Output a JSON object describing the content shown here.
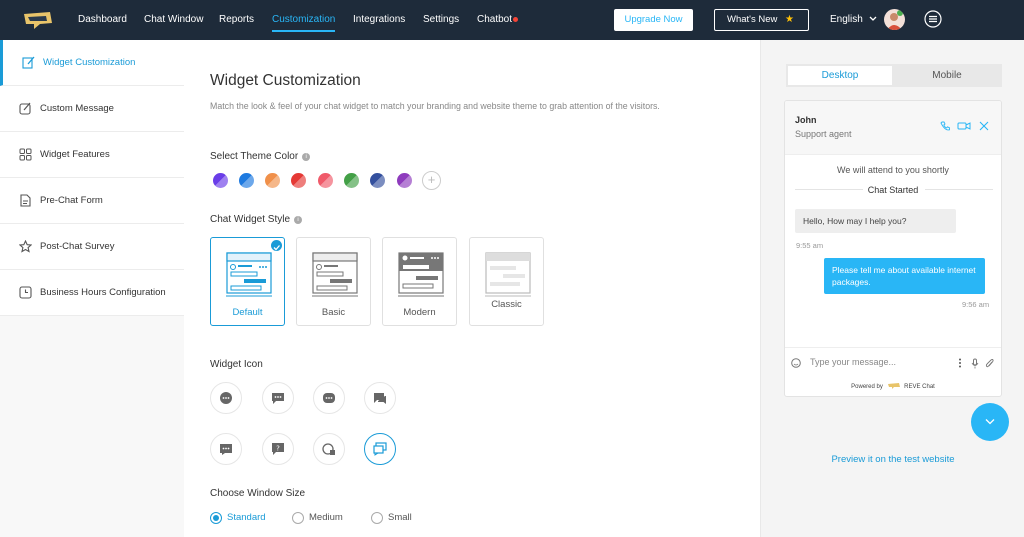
{
  "colors": {
    "accent": "#1a9bd7",
    "topbar": "#1e2b3a",
    "chat_bubble": "#29b6f6"
  },
  "nav": {
    "items": [
      {
        "label": "Dashboard"
      },
      {
        "label": "Chat Window"
      },
      {
        "label": "Reports"
      },
      {
        "label": "Customization"
      },
      {
        "label": "Integrations"
      },
      {
        "label": "Settings"
      },
      {
        "label": "Chatbot"
      }
    ],
    "upgrade_label": "Upgrade Now",
    "whats_new_label": "What's New",
    "language": "English"
  },
  "sidebar": {
    "items": [
      {
        "label": "Widget Customization",
        "icon": "edit-widget-icon"
      },
      {
        "label": "Custom Message",
        "icon": "edit-icon"
      },
      {
        "label": "Widget Features",
        "icon": "grid-icon"
      },
      {
        "label": "Pre-Chat Form",
        "icon": "form-icon"
      },
      {
        "label": "Post-Chat Survey",
        "icon": "star-icon"
      },
      {
        "label": "Business Hours Configuration",
        "icon": "clock-icon"
      }
    ]
  },
  "main": {
    "title": "Widget Customization",
    "description": "Match the look & feel of your chat widget to match your branding and website theme to grab attention of the visitors.",
    "theme_label": "Select Theme Color",
    "theme_colors": [
      "#6a3de8",
      "#1e7ae0",
      "#f0904a",
      "#e53935",
      "#f05a6a",
      "#43a047",
      "#34509e",
      "#8e3bbd"
    ],
    "style_label": "Chat Widget Style",
    "styles": [
      {
        "label": "Default"
      },
      {
        "label": "Basic"
      },
      {
        "label": "Modern"
      },
      {
        "label": "Classic"
      }
    ],
    "icon_label": "Widget Icon",
    "size_label": "Choose Window Size",
    "sizes": [
      {
        "label": "Standard"
      },
      {
        "label": "Medium"
      },
      {
        "label": "Small"
      }
    ]
  },
  "preview": {
    "tabs": [
      {
        "label": "Desktop"
      },
      {
        "label": "Mobile"
      }
    ],
    "agent_name": "John",
    "agent_role": "Support agent",
    "attend_text": "We will attend to you shortly",
    "chat_started": "Chat Started",
    "messages": [
      {
        "text": "Hello, How may I help you?",
        "time": "9:55 am"
      },
      {
        "text": "Please tell me about available internet packages.",
        "time": "9:56 am"
      }
    ],
    "input_placeholder": "Type your message...",
    "powered_by": "Powered by",
    "brand": "REVE Chat",
    "preview_link": "Preview it on the test website"
  }
}
